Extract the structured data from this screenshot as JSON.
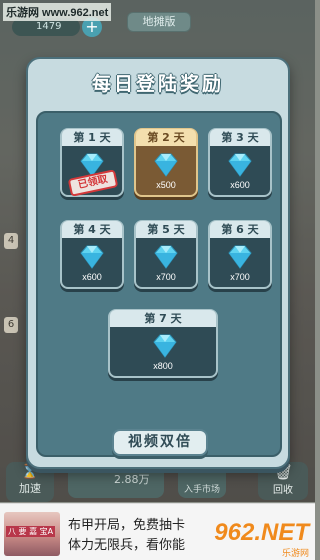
{
  "watermark": "乐游网 www.962.net",
  "hud": {
    "map_label": "地摊版",
    "coin_value": "1479",
    "plus_label": "+"
  },
  "slots": [
    "4",
    "6"
  ],
  "dialog": {
    "title": "每日登陆奖励",
    "days": [
      {
        "label": "第 1 天",
        "amount": "",
        "claimed": "已领取",
        "state": "claimed"
      },
      {
        "label": "第 2 天",
        "amount": "x500",
        "state": "today"
      },
      {
        "label": "第 3 天",
        "amount": "x600",
        "state": "locked"
      },
      {
        "label": "第 4 天",
        "amount": "x600",
        "state": "locked"
      },
      {
        "label": "第 5 天",
        "amount": "x700",
        "state": "locked"
      },
      {
        "label": "第 6 天",
        "amount": "x700",
        "state": "locked"
      },
      {
        "label": "第 7 天",
        "amount": "x800",
        "state": "locked"
      }
    ],
    "video_button": "视频双倍",
    "reward_icon": "diamond-icon"
  },
  "bottom_bar": {
    "speedup_label": "加速",
    "price": "2.88万",
    "recruit_label": "入手市场",
    "trash_label": "回收"
  },
  "ad": {
    "thumb_label": "八 要 嘉 宝A",
    "line1": "布甲开局，免费抽卡",
    "line2": "体力无限兵，看你能",
    "logo": "962.NET",
    "logo_sub": "乐游网"
  },
  "colors": {
    "dialog_bg": "#c7dbe0",
    "card_bg": "#2f4b55",
    "today_card_bg": "#7a5a34",
    "stamp_red": "#d4383a",
    "gem_blue": "#5fd3f0"
  }
}
